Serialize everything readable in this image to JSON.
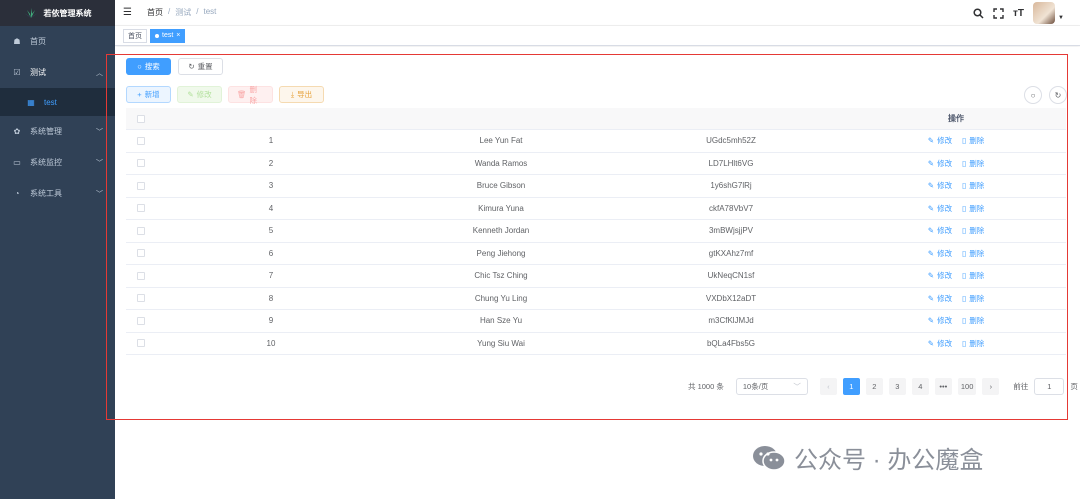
{
  "app": {
    "title": "若依管理系统"
  },
  "sidebar": {
    "items": [
      {
        "label": "首页",
        "icon": "dashboard-icon",
        "glyph": "☗"
      },
      {
        "label": "测试",
        "icon": "checkbox-icon",
        "glyph": "☑",
        "expanded": true,
        "children": [
          {
            "label": "test",
            "icon": "grid-icon",
            "glyph": "▦"
          }
        ]
      },
      {
        "label": "系统管理",
        "icon": "gear-icon",
        "glyph": "✿"
      },
      {
        "label": "系统监控",
        "icon": "monitor-icon",
        "glyph": "▭"
      },
      {
        "label": "系统工具",
        "icon": "tool-icon",
        "glyph": "◔"
      }
    ]
  },
  "navbar": {
    "breadcrumb": [
      "首页",
      "/",
      "测试",
      "/",
      "test"
    ]
  },
  "tags": [
    {
      "label": "首页",
      "active": false
    },
    {
      "label": "test",
      "active": true,
      "close": "×"
    }
  ],
  "toolbar": {
    "search": "搜索",
    "reset": "重置",
    "add": "新增",
    "edit": "修改",
    "delete": "删除",
    "export": "导出"
  },
  "table": {
    "op_header": "操作",
    "edit_label": "修改",
    "delete_label": "删除",
    "rows": [
      {
        "id": "1",
        "name": "Lee Yun Fat",
        "code": "UGdc5mh52Z"
      },
      {
        "id": "2",
        "name": "Wanda Ramos",
        "code": "LD7LHlt6VG"
      },
      {
        "id": "3",
        "name": "Bruce Gibson",
        "code": "1y6shG7lRj"
      },
      {
        "id": "4",
        "name": "Kimura Yuna",
        "code": "ckfA78VbV7"
      },
      {
        "id": "5",
        "name": "Kenneth Jordan",
        "code": "3mBWjsjjPV"
      },
      {
        "id": "6",
        "name": "Peng Jiehong",
        "code": "gtKXAhz7mf"
      },
      {
        "id": "7",
        "name": "Chic Tsz Ching",
        "code": "UkNeqCN1sf"
      },
      {
        "id": "8",
        "name": "Chung Yu Ling",
        "code": "VXDbX12aDT"
      },
      {
        "id": "9",
        "name": "Han Sze Yu",
        "code": "m3CfKlJMJd"
      },
      {
        "id": "10",
        "name": "Yung Siu Wai",
        "code": "bQLa4Fbs5G"
      }
    ]
  },
  "pagination": {
    "total": "共 1000 条",
    "page_size": "10条/页",
    "prev": "‹",
    "next": "›",
    "pages": [
      "1",
      "2",
      "3",
      "4",
      "•••",
      "100"
    ],
    "goto_label": "前往",
    "goto_value": "1",
    "goto_suffix": "页"
  },
  "watermark": {
    "text": "公众号 · 办公魔盒"
  },
  "colors": {
    "primary": "#409eff",
    "sidebar": "#304156",
    "frame": "#e53935"
  }
}
